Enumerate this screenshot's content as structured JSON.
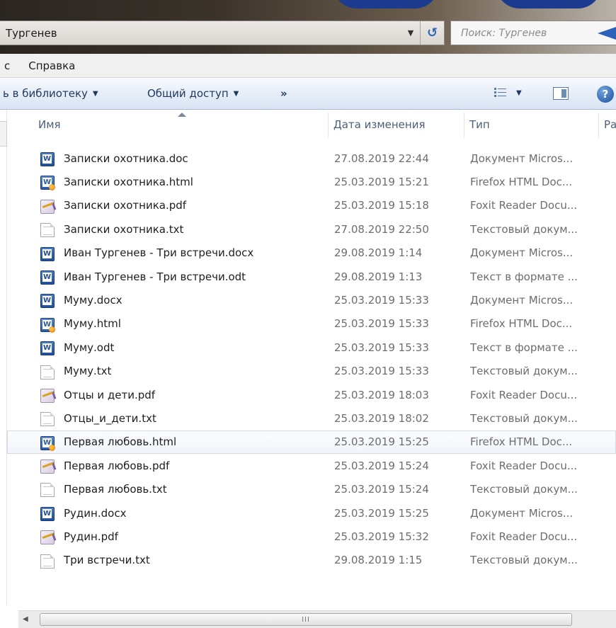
{
  "address": {
    "path": "Тургенев",
    "dropdown_icon": "chevron-down-icon",
    "refresh_icon": "refresh-icon"
  },
  "search": {
    "placeholder": "Поиск: Тургенев"
  },
  "menu": {
    "items": [
      "с",
      "Справка"
    ]
  },
  "toolbar": {
    "library_label": "ь в библиотеку",
    "share_label": "Общий доступ",
    "more_label": "»",
    "help_label": "?"
  },
  "columns": {
    "name": "Имя",
    "date": "Дата изменения",
    "type": "Тип",
    "size": "Ра"
  },
  "files": [
    {
      "name": "Записки охотника.doc",
      "date": "27.08.2019 22:44",
      "type": "Документ Micros...",
      "icon": "doc"
    },
    {
      "name": "Записки охотника.html",
      "date": "25.03.2019 15:21",
      "type": "Firefox HTML Doc...",
      "icon": "html"
    },
    {
      "name": "Записки охотника.pdf",
      "date": "25.03.2019 15:18",
      "type": "Foxit Reader Docu...",
      "icon": "pdf"
    },
    {
      "name": "Записки охотника.txt",
      "date": "27.08.2019 22:50",
      "type": "Текстовый докум...",
      "icon": "txt"
    },
    {
      "name": "Иван Тургенев - Три встречи.docx",
      "date": "29.08.2019 1:14",
      "type": "Документ Micros...",
      "icon": "doc"
    },
    {
      "name": "Иван Тургенев - Три встречи.odt",
      "date": "29.08.2019 1:13",
      "type": "Текст в формате ...",
      "icon": "doc"
    },
    {
      "name": "Муму.docx",
      "date": "25.03.2019 15:33",
      "type": "Документ Micros...",
      "icon": "doc"
    },
    {
      "name": "Муму.html",
      "date": "25.03.2019 15:33",
      "type": "Firefox HTML Doc...",
      "icon": "html"
    },
    {
      "name": "Муму.odt",
      "date": "25.03.2019 15:33",
      "type": "Текст в формате ...",
      "icon": "doc"
    },
    {
      "name": "Муму.txt",
      "date": "25.03.2019 15:33",
      "type": "Текстовый докум...",
      "icon": "txt"
    },
    {
      "name": "Отцы и дети.pdf",
      "date": "25.03.2019 18:03",
      "type": "Foxit Reader Docu...",
      "icon": "pdf"
    },
    {
      "name": "Отцы_и_дети.txt",
      "date": "25.03.2019 18:02",
      "type": "Текстовый докум...",
      "icon": "txt"
    },
    {
      "name": "Первая любовь.html",
      "date": "25.03.2019 15:25",
      "type": "Firefox HTML Doc...",
      "icon": "html",
      "selected": true
    },
    {
      "name": "Первая любовь.pdf",
      "date": "25.03.2019 15:24",
      "type": "Foxit Reader Docu...",
      "icon": "pdf"
    },
    {
      "name": "Первая любовь.txt",
      "date": "25.03.2019 15:24",
      "type": "Текстовый докум...",
      "icon": "txt"
    },
    {
      "name": "Рудин.docx",
      "date": "25.03.2019 15:25",
      "type": "Документ Micros...",
      "icon": "doc"
    },
    {
      "name": "Рудин.pdf",
      "date": "25.03.2019 15:32",
      "type": "Foxit Reader Docu...",
      "icon": "pdf"
    },
    {
      "name": "Три встречи.txt",
      "date": "29.08.2019 1:15",
      "type": "Текстовый докум...",
      "icon": "txt"
    }
  ],
  "scrollbar": {
    "thumb_grip": "III"
  },
  "colors": {
    "accent": "#2c63b9",
    "selection_border": "#d2dbe6",
    "secondary_text": "#6d6d6d"
  }
}
